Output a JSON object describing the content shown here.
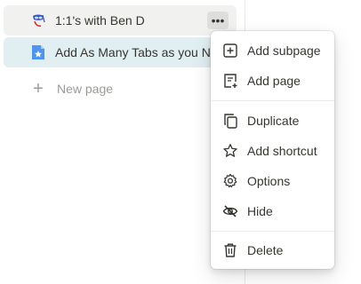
{
  "sidebar": {
    "pages": [
      {
        "label": "1:1's with Ben D",
        "icon": "diving-mask-icon"
      },
      {
        "label": "Add As Many Tabs as you Need",
        "icon": "starred-document-icon"
      }
    ],
    "new_page": {
      "label": "New page",
      "icon": "plus-icon"
    },
    "more_button": {
      "label": "•••",
      "icon": "more-horizontal-icon"
    }
  },
  "context_menu": {
    "items": [
      {
        "label": "Add subpage",
        "icon": "square-plus-icon"
      },
      {
        "label": "Add page",
        "icon": "page-plus-icon"
      },
      {
        "label": "Duplicate",
        "icon": "duplicate-icon"
      },
      {
        "label": "Add shortcut",
        "icon": "star-icon"
      },
      {
        "label": "Options",
        "icon": "gear-icon"
      },
      {
        "label": "Hide",
        "icon": "eye-slash-icon"
      },
      {
        "label": "Delete",
        "icon": "trash-icon"
      }
    ]
  },
  "colors": {
    "text": "#37352f",
    "muted": "#9b9a97",
    "selected_row": "#e1eef2",
    "hover_row": "#f1f1ef"
  }
}
